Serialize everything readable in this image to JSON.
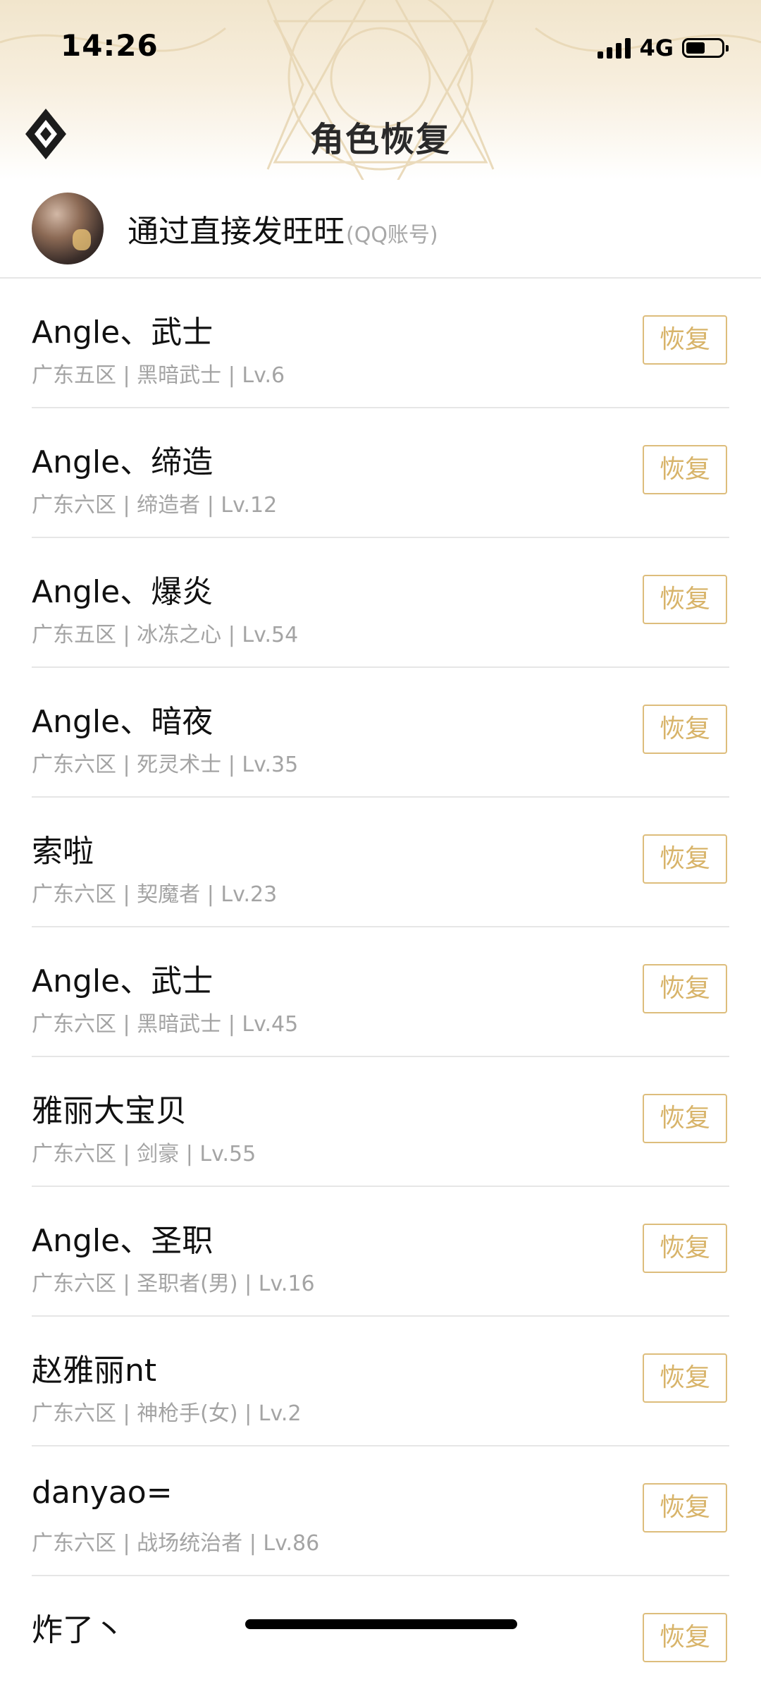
{
  "status_bar": {
    "time": "14:26",
    "network": "4G",
    "battery_fraction": 0.55
  },
  "header": {
    "title": "角色恢复",
    "back_icon": "diamond-back-icon",
    "accent_color": "#dcbb79"
  },
  "account": {
    "name": "通过直接发旺旺",
    "note": "(QQ账号)"
  },
  "roles": [
    {
      "name": "Angle、武士",
      "meta": "广东五区 | 黑暗武士 | Lv.6",
      "button": "恢复"
    },
    {
      "name": "Angle、缔造",
      "meta": "广东六区 | 缔造者 | Lv.12",
      "button": "恢复"
    },
    {
      "name": "Angle、爆炎",
      "meta": "广东五区 | 冰冻之心 | Lv.54",
      "button": "恢复"
    },
    {
      "name": "Angle、暗夜",
      "meta": "广东六区 | 死灵术士 | Lv.35",
      "button": "恢复"
    },
    {
      "name": "索啦",
      "meta": "广东六区 | 契魔者 | Lv.23",
      "button": "恢复"
    },
    {
      "name": "Angle、武士",
      "meta": "广东六区 | 黑暗武士 | Lv.45",
      "button": "恢复"
    },
    {
      "name": "雅丽大宝贝",
      "meta": "广东六区 | 剑豪 | Lv.55",
      "button": "恢复"
    },
    {
      "name": "Angle、圣职",
      "meta": "广东六区 | 圣职者(男) | Lv.16",
      "button": "恢复"
    },
    {
      "name": "赵雅丽nt",
      "meta": "广东六区 | 神枪手(女) | Lv.2",
      "button": "恢复"
    },
    {
      "name": "danyao=",
      "meta": "广东六区 | 战场统治者 | Lv.86",
      "button": "恢复"
    },
    {
      "name": "炸了丶",
      "meta": "",
      "button": "恢复"
    }
  ]
}
